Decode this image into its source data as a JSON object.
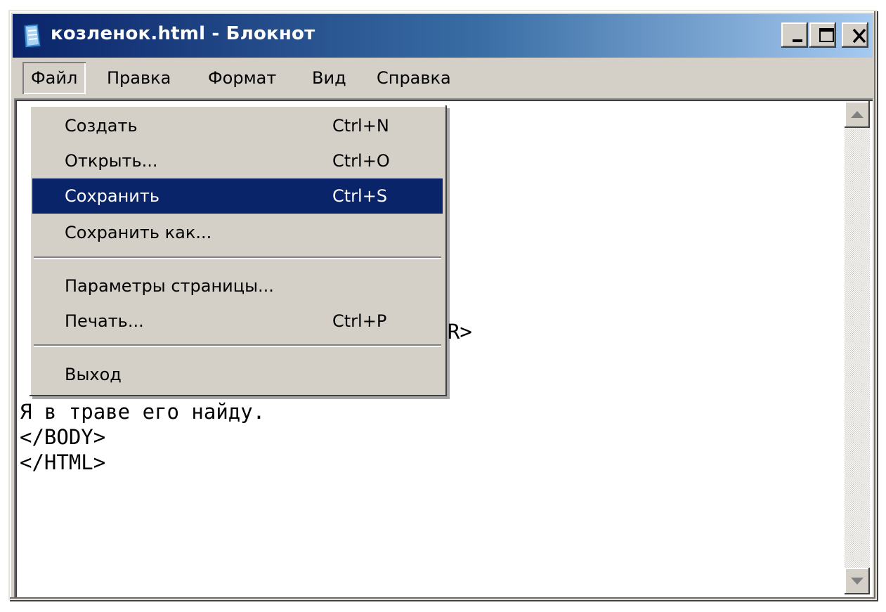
{
  "window": {
    "title": "козленок.html - Блокнот"
  },
  "menubar": {
    "items": [
      "Файл",
      "Правка",
      "Формат",
      "Вид",
      "Справка"
    ],
    "active": "Файл"
  },
  "file_menu": {
    "items": [
      {
        "label": "Создать",
        "shortcut": "Ctrl+N"
      },
      {
        "label": "Открыть...",
        "shortcut": "Ctrl+O"
      },
      {
        "label": "Сохранить",
        "shortcut": "Ctrl+S",
        "highlighted": true
      },
      {
        "label": "Сохранить как...",
        "shortcut": ""
      },
      {
        "label": "Параметры страницы...",
        "shortcut": ""
      },
      {
        "label": "Печать...",
        "shortcut": "Ctrl+P"
      },
      {
        "label": "Выход",
        "shortcut": ""
      }
    ]
  },
  "editor": {
    "visible_lines": [
      ">",
      "<BR>",
      "R>",
      "Я в траве его найду.",
      "</BODY>",
      "</HTML>"
    ]
  },
  "icons": {
    "app": "notepad-icon",
    "minimize": "minimize-icon",
    "maximize": "maximize-icon",
    "close": "close-icon",
    "scroll_up": "arrow-up-icon",
    "scroll_down": "arrow-down-icon"
  },
  "colors": {
    "title_gradient_start": "#0a246a",
    "title_gradient_end": "#a6caf0",
    "menu_highlight": "#0a246a",
    "chrome": "#d4d0c8"
  }
}
